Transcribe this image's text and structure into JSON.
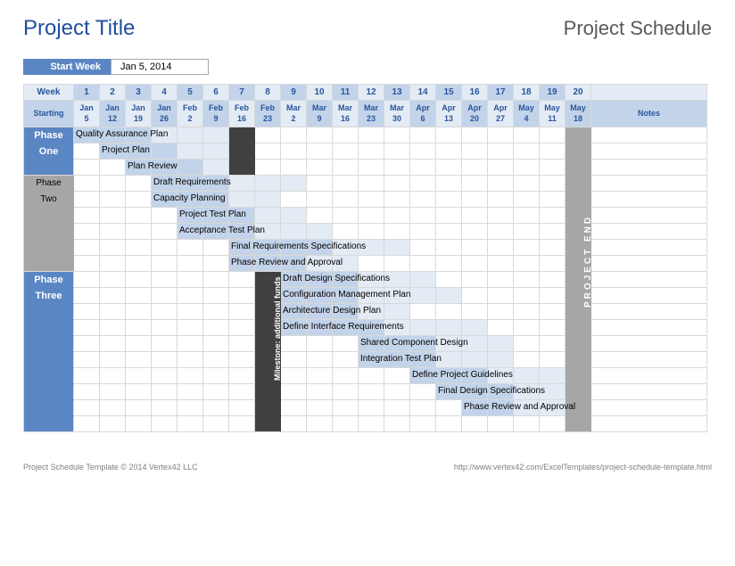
{
  "title": "Project Title",
  "subtitle": "Project Schedule",
  "start_week_label": "Start Week",
  "start_week_value": "Jan 5, 2014",
  "week_header": "Week",
  "starting_header": "Starting",
  "notes_header": "Notes",
  "weeks": [
    "1",
    "2",
    "3",
    "4",
    "5",
    "6",
    "7",
    "8",
    "9",
    "10",
    "11",
    "12",
    "13",
    "14",
    "15",
    "16",
    "17",
    "18",
    "19",
    "20"
  ],
  "dates_m": [
    "Jan",
    "Jan",
    "Jan",
    "Jan",
    "Feb",
    "Feb",
    "Feb",
    "Feb",
    "Mar",
    "Mar",
    "Mar",
    "Mar",
    "Mar",
    "Apr",
    "Apr",
    "Apr",
    "Apr",
    "May",
    "May",
    "May"
  ],
  "dates_d": [
    "5",
    "12",
    "19",
    "26",
    "2",
    "9",
    "16",
    "23",
    "2",
    "9",
    "16",
    "23",
    "30",
    "6",
    "13",
    "20",
    "27",
    "4",
    "11",
    "18"
  ],
  "phase1": "Phase",
  "phase1b": "One",
  "phase2": "Phase",
  "phase2b": "Two",
  "phase3": "Phase",
  "phase3b": "Three",
  "milestone_label": "Milestone: additional funds",
  "end_label": "PROJECT END",
  "footer_left": "Project Schedule Template © 2014 Vertex42 LLC",
  "footer_right": "http://www.vertex42.com/ExcelTemplates/project-schedule-template.html",
  "chart_data": {
    "type": "gantt",
    "unit": "week",
    "start_date": "2014-01-05",
    "weeks": 20,
    "phases": [
      {
        "name": "Phase One",
        "rows": [
          1,
          2,
          3
        ]
      },
      {
        "name": "Phase Two",
        "rows": [
          4,
          5,
          6,
          7,
          8,
          9
        ]
      },
      {
        "name": "Phase Three",
        "rows": [
          10,
          11,
          12,
          13,
          14,
          15,
          16,
          17,
          18,
          19
        ]
      }
    ],
    "milestone": {
      "week": 8,
      "label": "Milestone: additional funds"
    },
    "project_end_week": 20,
    "tasks": [
      {
        "name": "Quality Assurance Plan",
        "start": 1,
        "end": 6,
        "row": 1
      },
      {
        "name": "Project Plan",
        "start": 2,
        "end": 6,
        "row": 2
      },
      {
        "name": "Plan Review",
        "start": 3,
        "end": 7,
        "row": 3
      },
      {
        "name": "Draft Requirements",
        "start": 4,
        "end": 9,
        "row": 4
      },
      {
        "name": "Capacity Planning",
        "start": 4,
        "end": 8,
        "row": 5
      },
      {
        "name": "Project Test Plan",
        "start": 5,
        "end": 9,
        "row": 6
      },
      {
        "name": "Acceptance Test Plan",
        "start": 5,
        "end": 10,
        "row": 7
      },
      {
        "name": "Final Requirements Specifications",
        "start": 7,
        "end": 13,
        "row": 8
      },
      {
        "name": "Phase Review and Approval",
        "start": 7,
        "end": 11,
        "row": 9
      },
      {
        "name": "Draft Design Specifications",
        "start": 8,
        "end": 14,
        "row": 10
      },
      {
        "name": "Configuration Management Plan",
        "start": 8,
        "end": 15,
        "row": 11
      },
      {
        "name": "Architecture Design Plan",
        "start": 9,
        "end": 13,
        "row": 12
      },
      {
        "name": "Define Interface Requirements",
        "start": 9,
        "end": 16,
        "row": 13
      },
      {
        "name": "Shared Component Design",
        "start": 12,
        "end": 17,
        "row": 14
      },
      {
        "name": "Integration Test Plan",
        "start": 12,
        "end": 17,
        "row": 15
      },
      {
        "name": "Define Project Guidelines",
        "start": 14,
        "end": 19,
        "row": 16
      },
      {
        "name": "Final Design Specifications",
        "start": 15,
        "end": 19,
        "row": 17
      },
      {
        "name": "Phase Review and Approval",
        "start": 16,
        "end": 19,
        "row": 18
      }
    ]
  }
}
